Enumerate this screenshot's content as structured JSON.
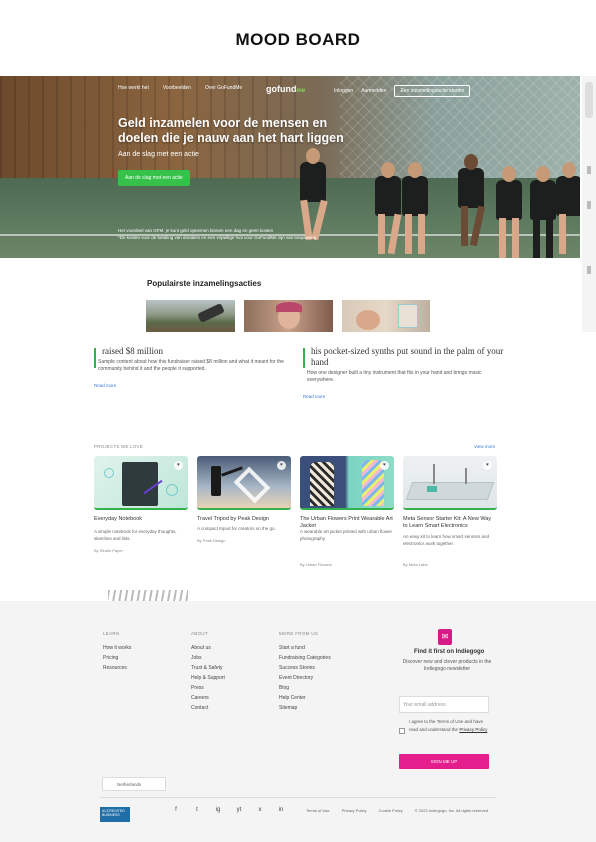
{
  "page_title": "MOOD BOARD",
  "hero": {
    "nav_left": [
      "Hoe werkt het",
      "Voorbeelden",
      "Over GoFundMe"
    ],
    "logo_text": "gofund",
    "logo_suffix": "me",
    "nav_right": [
      "Inloggen",
      "Aanmelden"
    ],
    "nav_cta": "Een inzamelingsactie starten",
    "headline": "Geld inzamelen voor de mensen en doelen die je nauw aan het hart liggen",
    "subtext": "Aan de slag met een actie",
    "cta_button": "Aan de slag met een actie",
    "note_line1": "Het voordeel van GFM: je kunt geld opnemen binnen een dag en geen kosten",
    "note_line2": "*De kosten voor de betaling van donaties en een vrijwillige fooi voor GoFundMe zijn van toepassing."
  },
  "popular": {
    "title": "Populairste inzamelingsacties"
  },
  "stories": [
    {
      "title": "raised $8 million",
      "body": "Sample content about how this fundraiser raised $8 million and what it meant for the community behind it and the people it supported.",
      "more": "Read more"
    },
    {
      "title": "his pocket-sized synths put sound in the palm of your hand",
      "body": "How one designer built a tiny instrument that fits in your hand and brings music everywhere.",
      "more": "Read more"
    }
  ],
  "products": {
    "label": "PROJECTS WE LOVE",
    "view_all": "View more",
    "cards": [
      {
        "title": "Everyday Notebook",
        "desc": "A simple notebook for everyday thoughts, sketches and lists.",
        "footer": "By Studio Paper"
      },
      {
        "title": "Travel Tripod by Peak Design",
        "desc": "A compact tripod for creators on the go.",
        "footer": "By Peak Design"
      },
      {
        "title": "The Urban Flowers Print Wearable Art Jacket",
        "desc": "A wearable art jacket printed with urban flower photography.",
        "footer": "By Urban Flowers"
      },
      {
        "title": "Meta Sensor Starter Kit: A New Way to Learn Smart Electronics",
        "desc": "An easy kit to learn how smart sensors and electronics work together.",
        "footer": "By Meta Labs"
      }
    ]
  },
  "footer": {
    "col1": {
      "heading": "LEARN",
      "items": [
        "How it works",
        "Pricing",
        "Resources"
      ]
    },
    "col2": {
      "heading": "ABOUT",
      "items": [
        "About us",
        "Jobs",
        "Trust & Safety",
        "Help & Support",
        "Press",
        "Careers",
        "Contact"
      ]
    },
    "col3": {
      "heading": "MORE FROM US",
      "items": [
        "Start a fund",
        "Fundraising Categories",
        "Success Stories",
        "Event Directory",
        "Blog",
        "Help Center",
        "Sitemap"
      ]
    },
    "newsletter": {
      "icon": "envelope-icon",
      "title": "Find it first on Indiegogo",
      "sub": "Discover new and clever products in the Indiegogo newsletter",
      "placeholder": "Your email address",
      "agree": "I agree to the Terms of Use and have read and understand the",
      "agree_link": "Privacy Policy",
      "button": "SIGN ME UP"
    },
    "language": "Netherlands",
    "bbb_text": "ACCREDITED BUSINESS",
    "socials": [
      "f",
      "t",
      "ig",
      "yt",
      "x",
      "in"
    ],
    "links": [
      "Terms of Use",
      "Privacy Policy",
      "Cookie Policy",
      "© 2023 Indiegogo, Inc. All rights reserved"
    ]
  },
  "colors": {
    "accent_green": "#36b04a",
    "accent_pink": "#e41e8c",
    "link_blue": "#3a7bd5"
  }
}
